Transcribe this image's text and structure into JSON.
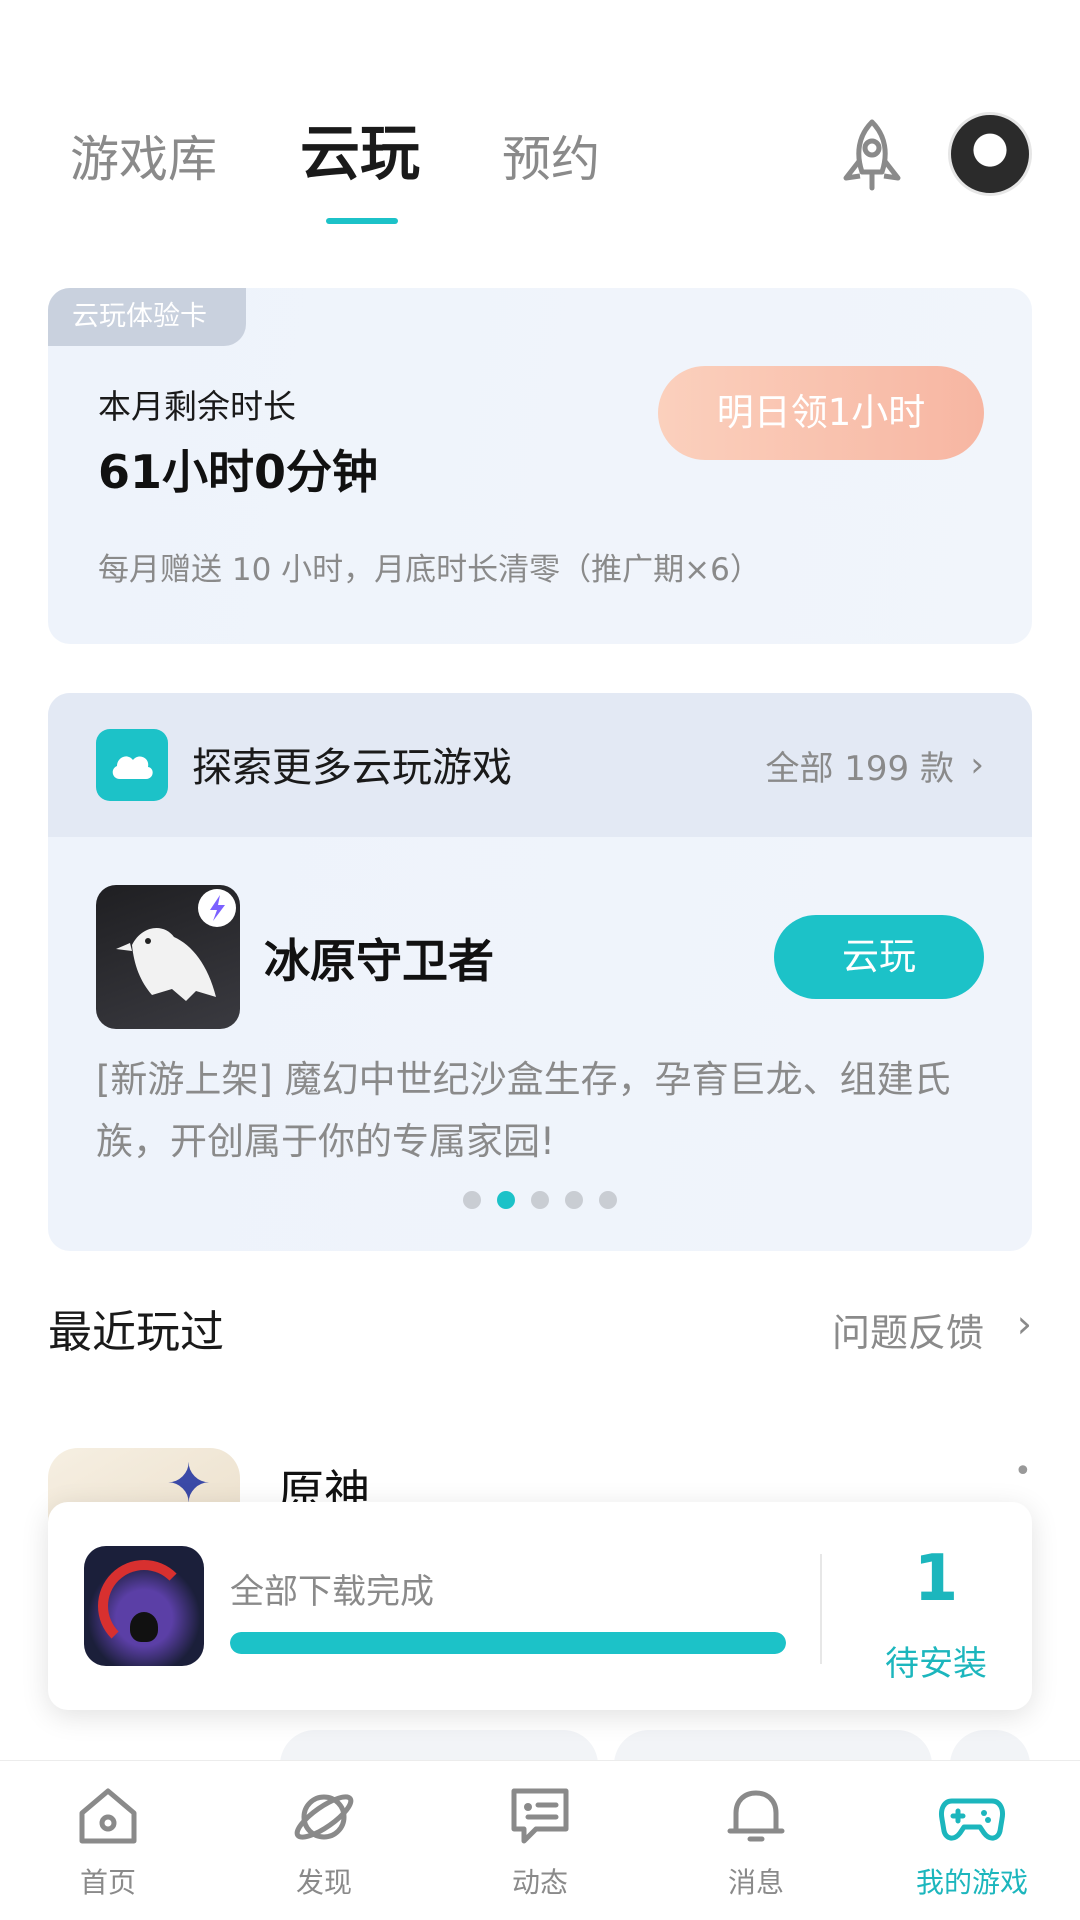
{
  "top_tabs": [
    {
      "label": "游戏库",
      "active": false
    },
    {
      "label": "云玩",
      "active": true
    },
    {
      "label": "预约",
      "active": false
    }
  ],
  "trial_card": {
    "tag": "云玩体验卡",
    "label": "本月剩余时长",
    "remaining": "61小时0分钟",
    "claim_button": "明日领1小时",
    "note": "每月赠送 10 小时，月底时长清零（推广期×6）"
  },
  "explore": {
    "title": "探索更多云玩游戏",
    "all_label": "全部 199 款",
    "game": {
      "name": "冰原守卫者",
      "button": "云玩",
      "description": "[新游上架] 魔幻中世纪沙盒生存，孕育巨龙、组建氏族，开创属于你的专属家园!"
    },
    "carousel": {
      "count": 5,
      "active_index": 1
    }
  },
  "recent": {
    "title": "最近玩过",
    "feedback": "问题反馈",
    "games": [
      {
        "name": "原神"
      }
    ]
  },
  "download": {
    "status": "全部下载完成",
    "progress": 1.0,
    "count": "1",
    "count_label": "待安装"
  },
  "bottom_nav": [
    {
      "label": "首页",
      "icon": "home-icon",
      "active": false
    },
    {
      "label": "发现",
      "icon": "planet-icon",
      "active": false
    },
    {
      "label": "动态",
      "icon": "chat-card-icon",
      "active": false
    },
    {
      "label": "消息",
      "icon": "bell-icon",
      "active": false
    },
    {
      "label": "我的游戏",
      "icon": "gamepad-icon",
      "active": true
    }
  ],
  "colors": {
    "accent": "#1cc2c8",
    "claim_gradient": "#f7b6a2"
  }
}
